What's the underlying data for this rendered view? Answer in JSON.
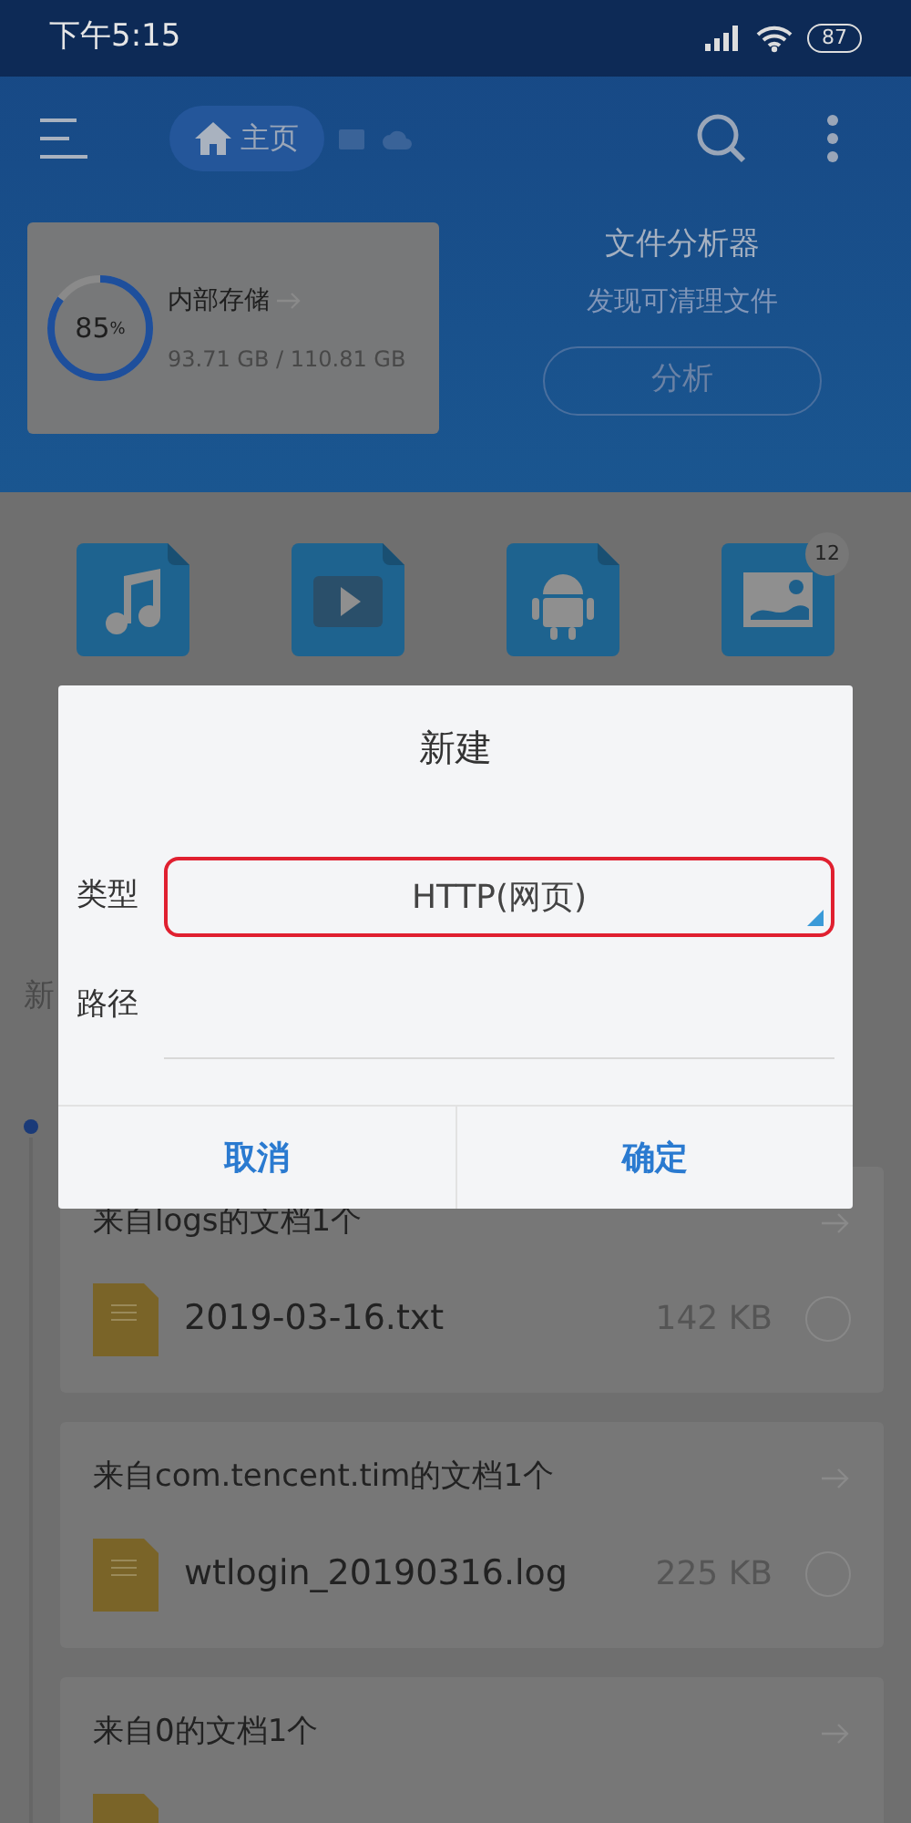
{
  "status_bar": {
    "time": "下午5:15",
    "battery": "87"
  },
  "toolbar": {
    "breadcrumb": "主页"
  },
  "storage": {
    "percent": "85",
    "percent_sign": "%",
    "level": 0.85,
    "name": "内部存储",
    "usage": "93.71 GB / 110.81 GB"
  },
  "analyzer": {
    "title": "文件分析器",
    "subtitle": "发现可清理文件",
    "button": "分析"
  },
  "categories": [
    {
      "kind": "music"
    },
    {
      "kind": "video"
    },
    {
      "kind": "app"
    },
    {
      "kind": "image",
      "badge": "12"
    }
  ],
  "section_title": "新",
  "cards": [
    {
      "title": "来自logs的文档1个",
      "files": [
        {
          "name": "2019-03-16.txt",
          "size": "142 KB",
          "selected": false
        }
      ]
    },
    {
      "title": "来自com.tencent.tim的文档1个",
      "files": [
        {
          "name": "wtlogin_20190316.log",
          "size": "225 KB",
          "selected": false
        }
      ]
    },
    {
      "title": "来自0的文档1个"
    }
  ],
  "dialog": {
    "title": "新建",
    "fields": [
      {
        "kind": "select",
        "label": "类型",
        "value": "HTTP(网页)",
        "highlighted": true
      },
      {
        "kind": "input",
        "label": "路径"
      }
    ],
    "buttons": [
      {
        "label": "取消"
      },
      {
        "label": "确定"
      }
    ]
  }
}
